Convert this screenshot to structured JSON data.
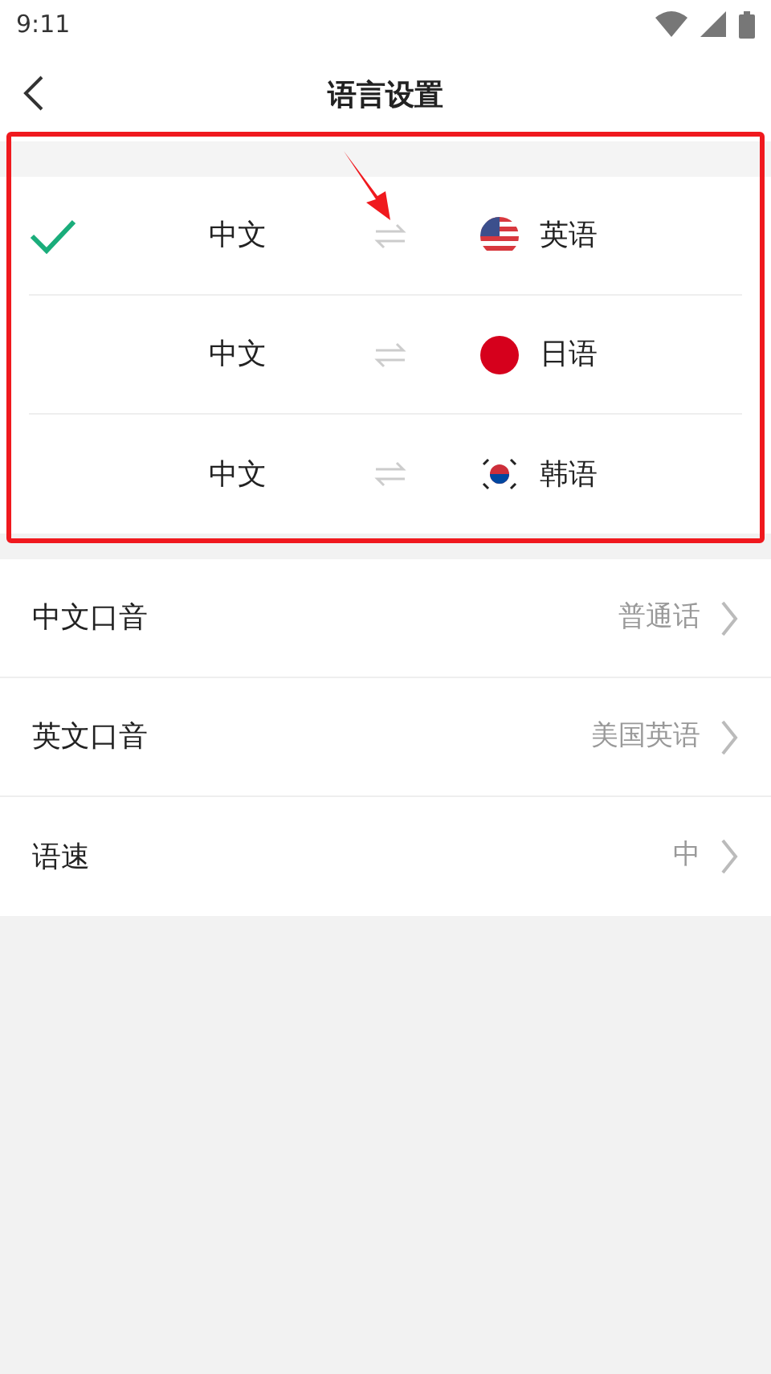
{
  "status_bar": {
    "time": "9:11"
  },
  "header": {
    "title": "语言设置"
  },
  "language_pairs": [
    {
      "source": "中文",
      "target": "英语",
      "kind": "us",
      "selected": true
    },
    {
      "source": "中文",
      "target": "日语",
      "kind": "jp",
      "selected": false
    },
    {
      "source": "中文",
      "target": "韩语",
      "kind": "kr",
      "selected": false
    }
  ],
  "settings": [
    {
      "label": "中文口音",
      "value": "普通话"
    },
    {
      "label": "英文口音",
      "value": "美国英语"
    },
    {
      "label": "语速",
      "value": "中"
    }
  ],
  "annotation": {
    "frame": true,
    "arrow": true
  }
}
